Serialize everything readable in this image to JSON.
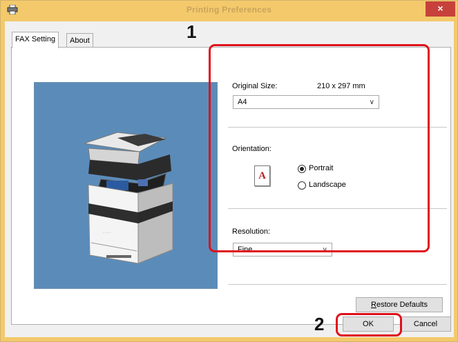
{
  "window": {
    "title": "Printing Preferences",
    "close_glyph": "×",
    "app_icon": "printer-icon"
  },
  "tabs": [
    {
      "label": "FAX Setting",
      "active": true
    },
    {
      "label": "About",
      "active": false
    }
  ],
  "original_size": {
    "label": "Original Size:",
    "dimensions": "210 x 297 mm",
    "selected": "A4"
  },
  "orientation": {
    "label": "Orientation:",
    "icon_letter": "A",
    "options": [
      {
        "label": "Portrait",
        "checked": true
      },
      {
        "label": "Landscape",
        "checked": false
      }
    ]
  },
  "resolution": {
    "label": "Resolution:",
    "selected": "Fine"
  },
  "buttons": {
    "restore_defaults_hotkey": "R",
    "restore_defaults_rest": "estore Defaults",
    "ok": "OK",
    "cancel": "Cancel"
  },
  "callouts": [
    {
      "number": "1"
    },
    {
      "number": "2"
    }
  ],
  "colors": {
    "titlebar": "#f3c96b",
    "close": "#c7413b",
    "preview_bg": "#5b8cb9",
    "callout": "#e0101a"
  }
}
